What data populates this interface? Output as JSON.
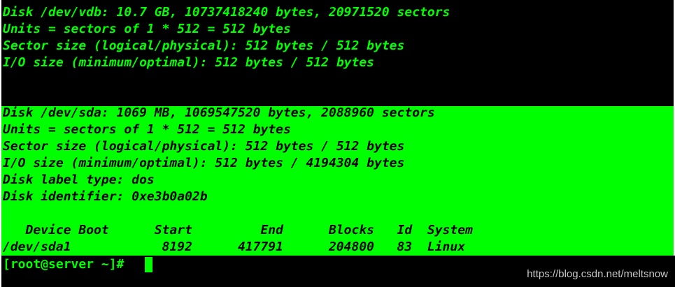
{
  "colors": {
    "background": "#000000",
    "foreground": "#00ff00",
    "highlight_bg": "#00ff00",
    "highlight_fg": "#000000"
  },
  "vdb": {
    "line1": "Disk /dev/vdb: 10.7 GB, 10737418240 bytes, 20971520 sectors",
    "line2": "Units = sectors of 1 * 512 = 512 bytes",
    "line3": "Sector size (logical/physical): 512 bytes / 512 bytes",
    "line4": "I/O size (minimum/optimal): 512 bytes / 512 bytes"
  },
  "sda": {
    "line1": "Disk /dev/sda: 1069 MB, 1069547520 bytes, 2088960 sectors",
    "line2": "Units = sectors of 1 * 512 = 512 bytes",
    "line3": "Sector size (logical/physical): 512 bytes / 512 bytes",
    "line4": "I/O size (minimum/optimal): 512 bytes / 4194304 bytes",
    "line5": "Disk label type: dos",
    "line6": "Disk identifier: 0xe3b0a02b",
    "table_header": "   Device Boot      Start         End      Blocks   Id  System",
    "table_row": "/dev/sda1            8192      417791      204800   83  Linux"
  },
  "prompt": {
    "text": "[root@server ~]# "
  },
  "watermark": "https://blog.csdn.net/meltsnow"
}
